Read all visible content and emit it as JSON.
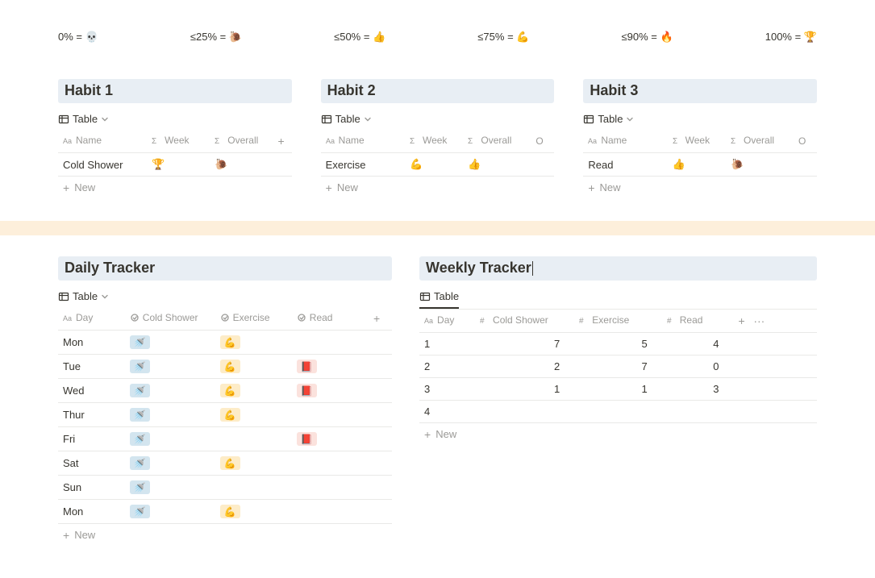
{
  "legend": [
    {
      "label": "0% = 💀"
    },
    {
      "label": "≤25% = 🐌"
    },
    {
      "label": "≤50% = 👍"
    },
    {
      "label": "≤75% = 💪"
    },
    {
      "label": "≤90% = 🔥"
    },
    {
      "label": "100% = 🏆"
    }
  ],
  "habits": [
    {
      "title": "Habit 1",
      "view": "Table",
      "columns": {
        "name": "Name",
        "week": "Week",
        "overall": "Overall"
      },
      "row": {
        "name": "Cold Shower",
        "week": "🏆",
        "overall": "🐌"
      },
      "new_label": "New"
    },
    {
      "title": "Habit 2",
      "view": "Table",
      "columns": {
        "name": "Name",
        "week": "Week",
        "overall": "Overall",
        "extra": "O"
      },
      "row": {
        "name": "Exercise",
        "week": "💪",
        "overall": "👍"
      },
      "new_label": "New"
    },
    {
      "title": "Habit 3",
      "view": "Table",
      "columns": {
        "name": "Name",
        "week": "Week",
        "overall": "Overall",
        "extra": "O"
      },
      "row": {
        "name": "Read",
        "week": "👍",
        "overall": "🐌"
      },
      "new_label": "New"
    }
  ],
  "daily": {
    "title": "Daily Tracker",
    "view": "Table",
    "columns": {
      "day": "Day",
      "c1": "Cold Shower",
      "c2": "Exercise",
      "c3": "Read"
    },
    "emoji": {
      "shower": "🚿",
      "flex": "💪",
      "book": "📕"
    },
    "rows": [
      {
        "day": "Mon",
        "c1": true,
        "c2": true,
        "c3": false
      },
      {
        "day": "Tue",
        "c1": true,
        "c2": true,
        "c3": true
      },
      {
        "day": "Wed",
        "c1": true,
        "c2": true,
        "c3": true
      },
      {
        "day": "Thur",
        "c1": true,
        "c2": true,
        "c3": false
      },
      {
        "day": "Fri",
        "c1": true,
        "c2": false,
        "c3": true
      },
      {
        "day": "Sat",
        "c1": true,
        "c2": true,
        "c3": false
      },
      {
        "day": "Sun",
        "c1": true,
        "c2": false,
        "c3": false
      },
      {
        "day": "Mon",
        "c1": true,
        "c2": true,
        "c3": false
      }
    ],
    "new_label": "New"
  },
  "weekly": {
    "title": "Weekly Tracker",
    "view": "Table",
    "columns": {
      "day": "Day",
      "c1": "Cold Shower",
      "c2": "Exercise",
      "c3": "Read"
    },
    "rows": [
      {
        "day": "1",
        "c1": "7",
        "c2": "5",
        "c3": "4"
      },
      {
        "day": "2",
        "c1": "2",
        "c2": "7",
        "c3": "0"
      },
      {
        "day": "3",
        "c1": "1",
        "c2": "1",
        "c3": "3"
      },
      {
        "day": "4",
        "c1": "",
        "c2": "",
        "c3": ""
      }
    ],
    "new_label": "New"
  }
}
